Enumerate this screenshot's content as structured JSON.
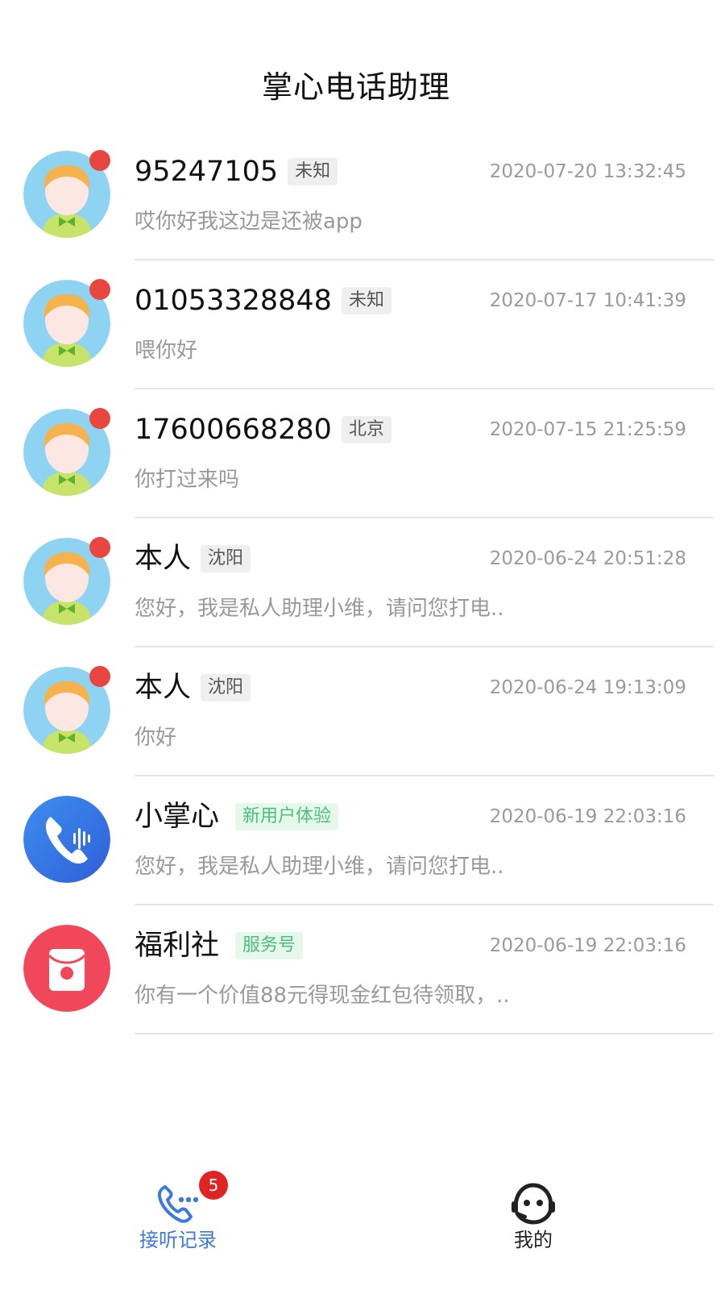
{
  "header": {
    "title": "掌心电话助理"
  },
  "calls": [
    {
      "name": "95247105",
      "tag": "未知",
      "tag_style": "gray",
      "time": "2020-07-20 13:32:45",
      "preview": "哎你好我这边是还被app",
      "avatar": "boy-avatar",
      "unread": true
    },
    {
      "name": "01053328848",
      "tag": "未知",
      "tag_style": "gray",
      "time": "2020-07-17 10:41:39",
      "preview": "喂你好",
      "avatar": "boy-avatar",
      "unread": true
    },
    {
      "name": "17600668280",
      "tag": "北京",
      "tag_style": "gray",
      "time": "2020-07-15 21:25:59",
      "preview": "你打过来吗",
      "avatar": "boy-avatar",
      "unread": true
    },
    {
      "name": "本人",
      "tag": "沈阳",
      "tag_style": "gray",
      "time": "2020-06-24 20:51:28",
      "preview": "您好，我是私人助理小维，请问您打电..",
      "avatar": "boy-avatar",
      "unread": true
    },
    {
      "name": "本人",
      "tag": "沈阳",
      "tag_style": "gray",
      "time": "2020-06-24 19:13:09",
      "preview": "你好",
      "avatar": "boy-avatar",
      "unread": true
    },
    {
      "name": "小掌心",
      "tag": "新用户体验",
      "tag_style": "green",
      "time": "2020-06-19 22:03:16",
      "preview": "您好，我是私人助理小维，请问您打电..",
      "avatar": "phone-voice-icon",
      "unread": false
    },
    {
      "name": "福利社",
      "tag": "服务号",
      "tag_style": "green",
      "time": "2020-06-19 22:03:16",
      "preview": "你有一个价值88元得现金红包待领取，..",
      "avatar": "red-packet-icon",
      "unread": false
    }
  ],
  "tabbar": {
    "tabs": [
      {
        "label": "接听记录",
        "icon": "phone-calls-icon",
        "badge": "5",
        "active": true
      },
      {
        "label": "我的",
        "icon": "assistant-face-icon",
        "active": false
      }
    ]
  },
  "colors": {
    "accent": "#3e7ad9",
    "unread": "#e8463e",
    "badge": "#e02424",
    "tag_green_text": "#4cc07a",
    "tag_green_bg": "#e6f7ec"
  }
}
